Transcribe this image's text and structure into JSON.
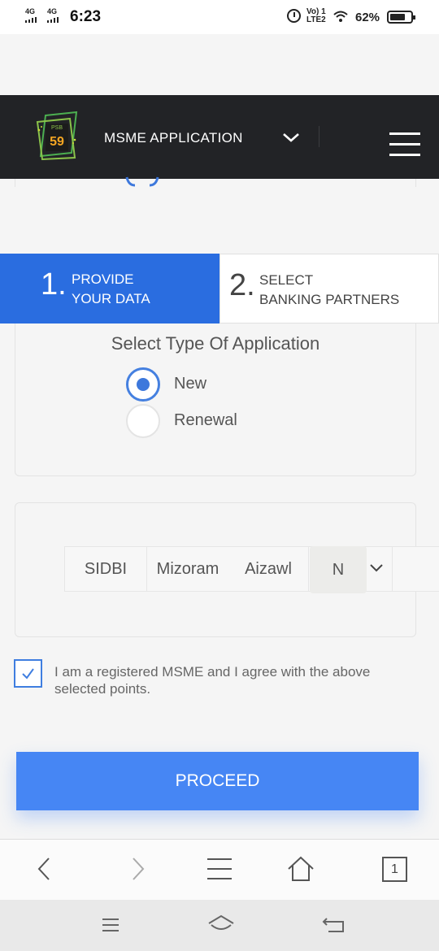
{
  "status_bar": {
    "network1": "4G",
    "network2": "4G",
    "time": "6:23",
    "volte_line1": "Vo) 1",
    "volte_line2": "LTE2",
    "battery": "62%"
  },
  "header": {
    "logo_top": "PSB",
    "logo_num": "59",
    "title": "MSME APPLICATION",
    "icons": [
      "chevron-down-icon",
      "hamburger-menu-icon"
    ]
  },
  "stepper": {
    "steps": [
      {
        "num": "1.",
        "line1": "PROVIDE",
        "line2": "YOUR DATA",
        "active": true
      },
      {
        "num": "2.",
        "line1": "SELECT",
        "line2": "BANKING PARTNERS",
        "active": false
      }
    ]
  },
  "application_type": {
    "title": "Select Type Of Application",
    "options": [
      {
        "label": "New",
        "selected": true
      },
      {
        "label": "Renewal",
        "selected": false
      }
    ]
  },
  "selection_row": {
    "cells": [
      "SIDBI",
      "Mizoram",
      "Aizawl",
      "N"
    ]
  },
  "agreement": {
    "text": "I am a registered MSME and I agree with the above selected points.",
    "checked": true
  },
  "proceed_button": "PROCEED",
  "browser_nav": {
    "tab_count": "1",
    "icons": [
      "back-icon",
      "forward-icon",
      "menu-icon",
      "home-icon",
      "tabs-icon"
    ]
  },
  "system_nav": {
    "icons": [
      "recents-icon",
      "home-icon",
      "back-icon"
    ]
  },
  "colors": {
    "accent": "#2a6de0",
    "button": "#4686f4",
    "header_bg": "#222326"
  }
}
